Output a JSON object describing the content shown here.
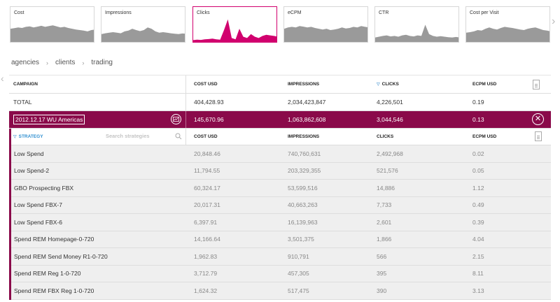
{
  "cards": [
    {
      "label": "Cost",
      "active": false,
      "color": "#9a9a9a",
      "points": [
        0.55,
        0.57,
        0.6,
        0.58,
        0.62,
        0.64,
        0.6,
        0.63,
        0.66,
        0.62,
        0.65,
        0.68,
        0.64,
        0.6,
        0.62,
        0.58,
        0.55,
        0.52,
        0.5,
        0.48,
        0.45,
        0.5,
        0.52
      ]
    },
    {
      "label": "Impressions",
      "active": false,
      "color": "#9a9a9a",
      "points": [
        0.35,
        0.38,
        0.4,
        0.42,
        0.4,
        0.38,
        0.45,
        0.48,
        0.55,
        0.5,
        0.46,
        0.5,
        0.6,
        0.55,
        0.45,
        0.4,
        0.42,
        0.4,
        0.38,
        0.36,
        0.35,
        0.37,
        0.36
      ]
    },
    {
      "label": "Clicks",
      "active": true,
      "color": "#d1006e",
      "points": [
        0.12,
        0.14,
        0.13,
        0.15,
        0.16,
        0.18,
        0.15,
        0.14,
        0.5,
        0.9,
        0.2,
        0.15,
        0.55,
        0.25,
        0.2,
        0.35,
        0.25,
        0.2,
        0.28,
        0.32,
        0.3,
        0.28,
        0.25
      ]
    },
    {
      "label": "eCPM",
      "active": false,
      "color": "#9a9a9a",
      "points": [
        0.55,
        0.6,
        0.62,
        0.6,
        0.65,
        0.63,
        0.6,
        0.62,
        0.58,
        0.55,
        0.52,
        0.55,
        0.5,
        0.52,
        0.55,
        0.6,
        0.56,
        0.58,
        0.62,
        0.6,
        0.65,
        0.62,
        0.6
      ]
    },
    {
      "label": "CTR",
      "active": false,
      "color": "#9a9a9a",
      "points": [
        0.22,
        0.25,
        0.28,
        0.3,
        0.26,
        0.28,
        0.25,
        0.3,
        0.32,
        0.28,
        0.26,
        0.3,
        0.28,
        0.7,
        0.35,
        0.28,
        0.25,
        0.27,
        0.25,
        0.23,
        0.22,
        0.24,
        0.22
      ]
    },
    {
      "label": "Cost per Visit",
      "active": false,
      "color": "#9a9a9a",
      "points": [
        0.4,
        0.42,
        0.45,
        0.5,
        0.48,
        0.55,
        0.6,
        0.55,
        0.52,
        0.58,
        0.62,
        0.6,
        0.58,
        0.55,
        0.52,
        0.5,
        0.55,
        0.58,
        0.6,
        0.55,
        0.5,
        0.48,
        0.45
      ]
    }
  ],
  "breadcrumb": [
    "agencies",
    "clients",
    "trading"
  ],
  "header": {
    "campaign": "CAMPAIGN",
    "cost": "COST USD",
    "impressions": "IMPRESSIONS",
    "clicks": "CLICKS",
    "ecpm": "ECPM USD"
  },
  "total": {
    "label": "TOTAL",
    "cost": "404,428.93",
    "impressions": "2,034,423,847",
    "clicks": "4,226,501",
    "ecpm": "0.19"
  },
  "campaign": {
    "name": "2012.12.17 WU Americas",
    "cost": "145,670.96",
    "impressions": "1,063,862,608",
    "clicks": "3,044,546",
    "ecpm": "0.13"
  },
  "sub_header": {
    "strategy": "STRATEGY",
    "search_placeholder": "Search strategies",
    "cost": "COST USD",
    "impressions": "IMPRESSIONS",
    "clicks": "CLICKS",
    "ecpm": "ECPM USD"
  },
  "strategies": [
    {
      "name": "Low Spend",
      "cost": "20,848.46",
      "impressions": "740,760,631",
      "clicks": "2,492,968",
      "ecpm": "0.02"
    },
    {
      "name": "Low Spend-2",
      "cost": "11,794.55",
      "impressions": "203,329,355",
      "clicks": "521,576",
      "ecpm": "0.05"
    },
    {
      "name": "GBO Prospecting FBX",
      "cost": "60,324.17",
      "impressions": "53,599,516",
      "clicks": "14,886",
      "ecpm": "1.12"
    },
    {
      "name": "Low Spend FBX-7",
      "cost": "20,017.31",
      "impressions": "40,663,263",
      "clicks": "7,733",
      "ecpm": "0.49"
    },
    {
      "name": "Low Spend FBX-6",
      "cost": "6,397.91",
      "impressions": "16,139,963",
      "clicks": "2,601",
      "ecpm": "0.39"
    },
    {
      "name": "Spend REM Homepage-0-720",
      "cost": "14,166.64",
      "impressions": "3,501,375",
      "clicks": "1,866",
      "ecpm": "4.04"
    },
    {
      "name": "Spend REM Send Money R1-0-720",
      "cost": "1,962.83",
      "impressions": "910,791",
      "clicks": "566",
      "ecpm": "2.15"
    },
    {
      "name": "Spend REM Reg 1-0-720",
      "cost": "3,712.79",
      "impressions": "457,305",
      "clicks": "395",
      "ecpm": "8.11"
    },
    {
      "name": "Spend REM FBX Reg 1-0-720",
      "cost": "1,624.32",
      "impressions": "517,475",
      "clicks": "390",
      "ecpm": "3.13"
    }
  ]
}
